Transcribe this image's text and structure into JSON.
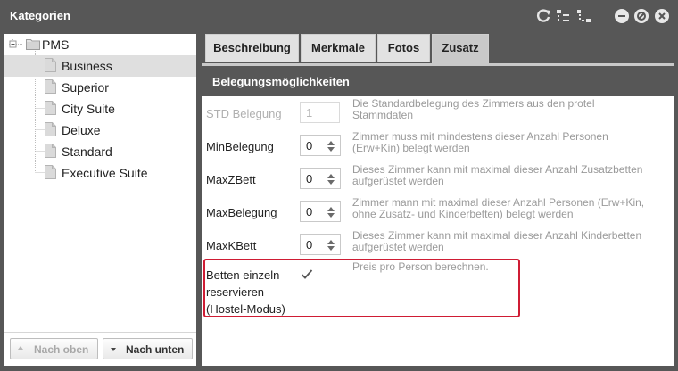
{
  "window": {
    "title": "Kategorien",
    "icons": [
      "refresh-icon",
      "expand-icon",
      "collapse-icon",
      "minimize-icon",
      "help-icon",
      "close-icon"
    ]
  },
  "tree": {
    "root": "PMS",
    "items": [
      {
        "label": "Business",
        "selected": true
      },
      {
        "label": "Superior",
        "selected": false
      },
      {
        "label": "City Suite",
        "selected": false
      },
      {
        "label": "Deluxe",
        "selected": false
      },
      {
        "label": "Standard",
        "selected": false
      },
      {
        "label": "Executive Suite",
        "selected": false
      }
    ]
  },
  "left_buttons": {
    "up": "Nach oben",
    "down": "Nach unten"
  },
  "tabs": [
    {
      "label": "Beschreibung",
      "active": false
    },
    {
      "label": "Merkmale",
      "active": false
    },
    {
      "label": "Fotos",
      "active": false
    },
    {
      "label": "Zusatz",
      "active": true
    }
  ],
  "section": {
    "title": "Belegungsmöglichkeiten"
  },
  "fields": [
    {
      "label": "STD Belegung",
      "value": "1",
      "disabled": true,
      "description": [
        "Die Standardbelegung des Zimmers aus den protel",
        "Stammdaten"
      ]
    },
    {
      "label": "MinBelegung",
      "value": "0",
      "disabled": false,
      "description": [
        "Zimmer muss mit mindestens dieser Anzahl Personen",
        "(Erw+Kin) belegt werden"
      ]
    },
    {
      "label": "MaxZBett",
      "value": "0",
      "disabled": false,
      "description": [
        "Dieses Zimmer kann mit maximal dieser Anzahl Zusatzbetten",
        "aufgerüstet werden"
      ]
    },
    {
      "label": "MaxBelegung",
      "value": "0",
      "disabled": false,
      "description": [
        "Zimmer mann mit maximal dieser Anzahl Personen (Erw+Kin,",
        "ohne Zusatz- und Kinderbetten) belegt werden"
      ]
    },
    {
      "label": "MaxKBett",
      "value": "0",
      "disabled": false,
      "description": [
        "Dieses Zimmer kann mit maximal dieser Anzahl Kinderbetten",
        "aufgerüstet werden"
      ]
    }
  ],
  "hostel": {
    "label_lines": [
      "Betten einzeln",
      "reservieren",
      "(Hostel-Modus)"
    ],
    "checked": true,
    "description": "Preis pro Person berechnen."
  },
  "colors": {
    "titlebar": "#575757",
    "highlight": "#cf1c34",
    "selected_row": "#dfdfdf"
  }
}
